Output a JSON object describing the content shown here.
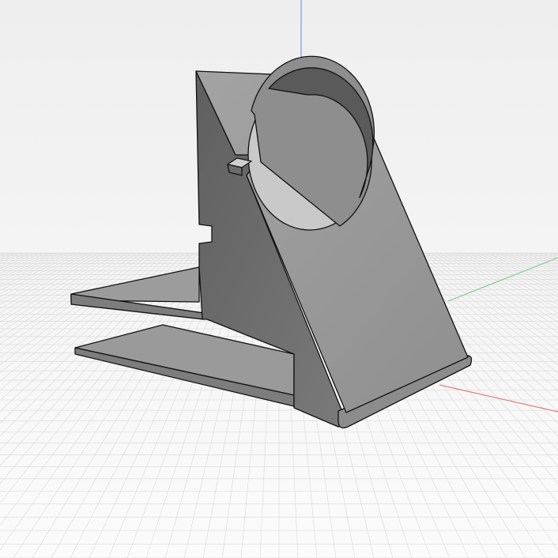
{
  "viewport": {
    "background_top": "#f1f1f1",
    "background_bottom": "#fafafa",
    "grid_color": "#d8d8d8",
    "axes": {
      "z_color": "#7a9bd9",
      "x_color": "#e08080",
      "y_color": "#86c98f"
    }
  },
  "model": {
    "name": "phone-watch-stand",
    "body_color_light": "#9b9b9b",
    "body_color_mid": "#8a8a8a",
    "body_color_dark": "#6e6e6e",
    "edge_color": "#111111"
  }
}
